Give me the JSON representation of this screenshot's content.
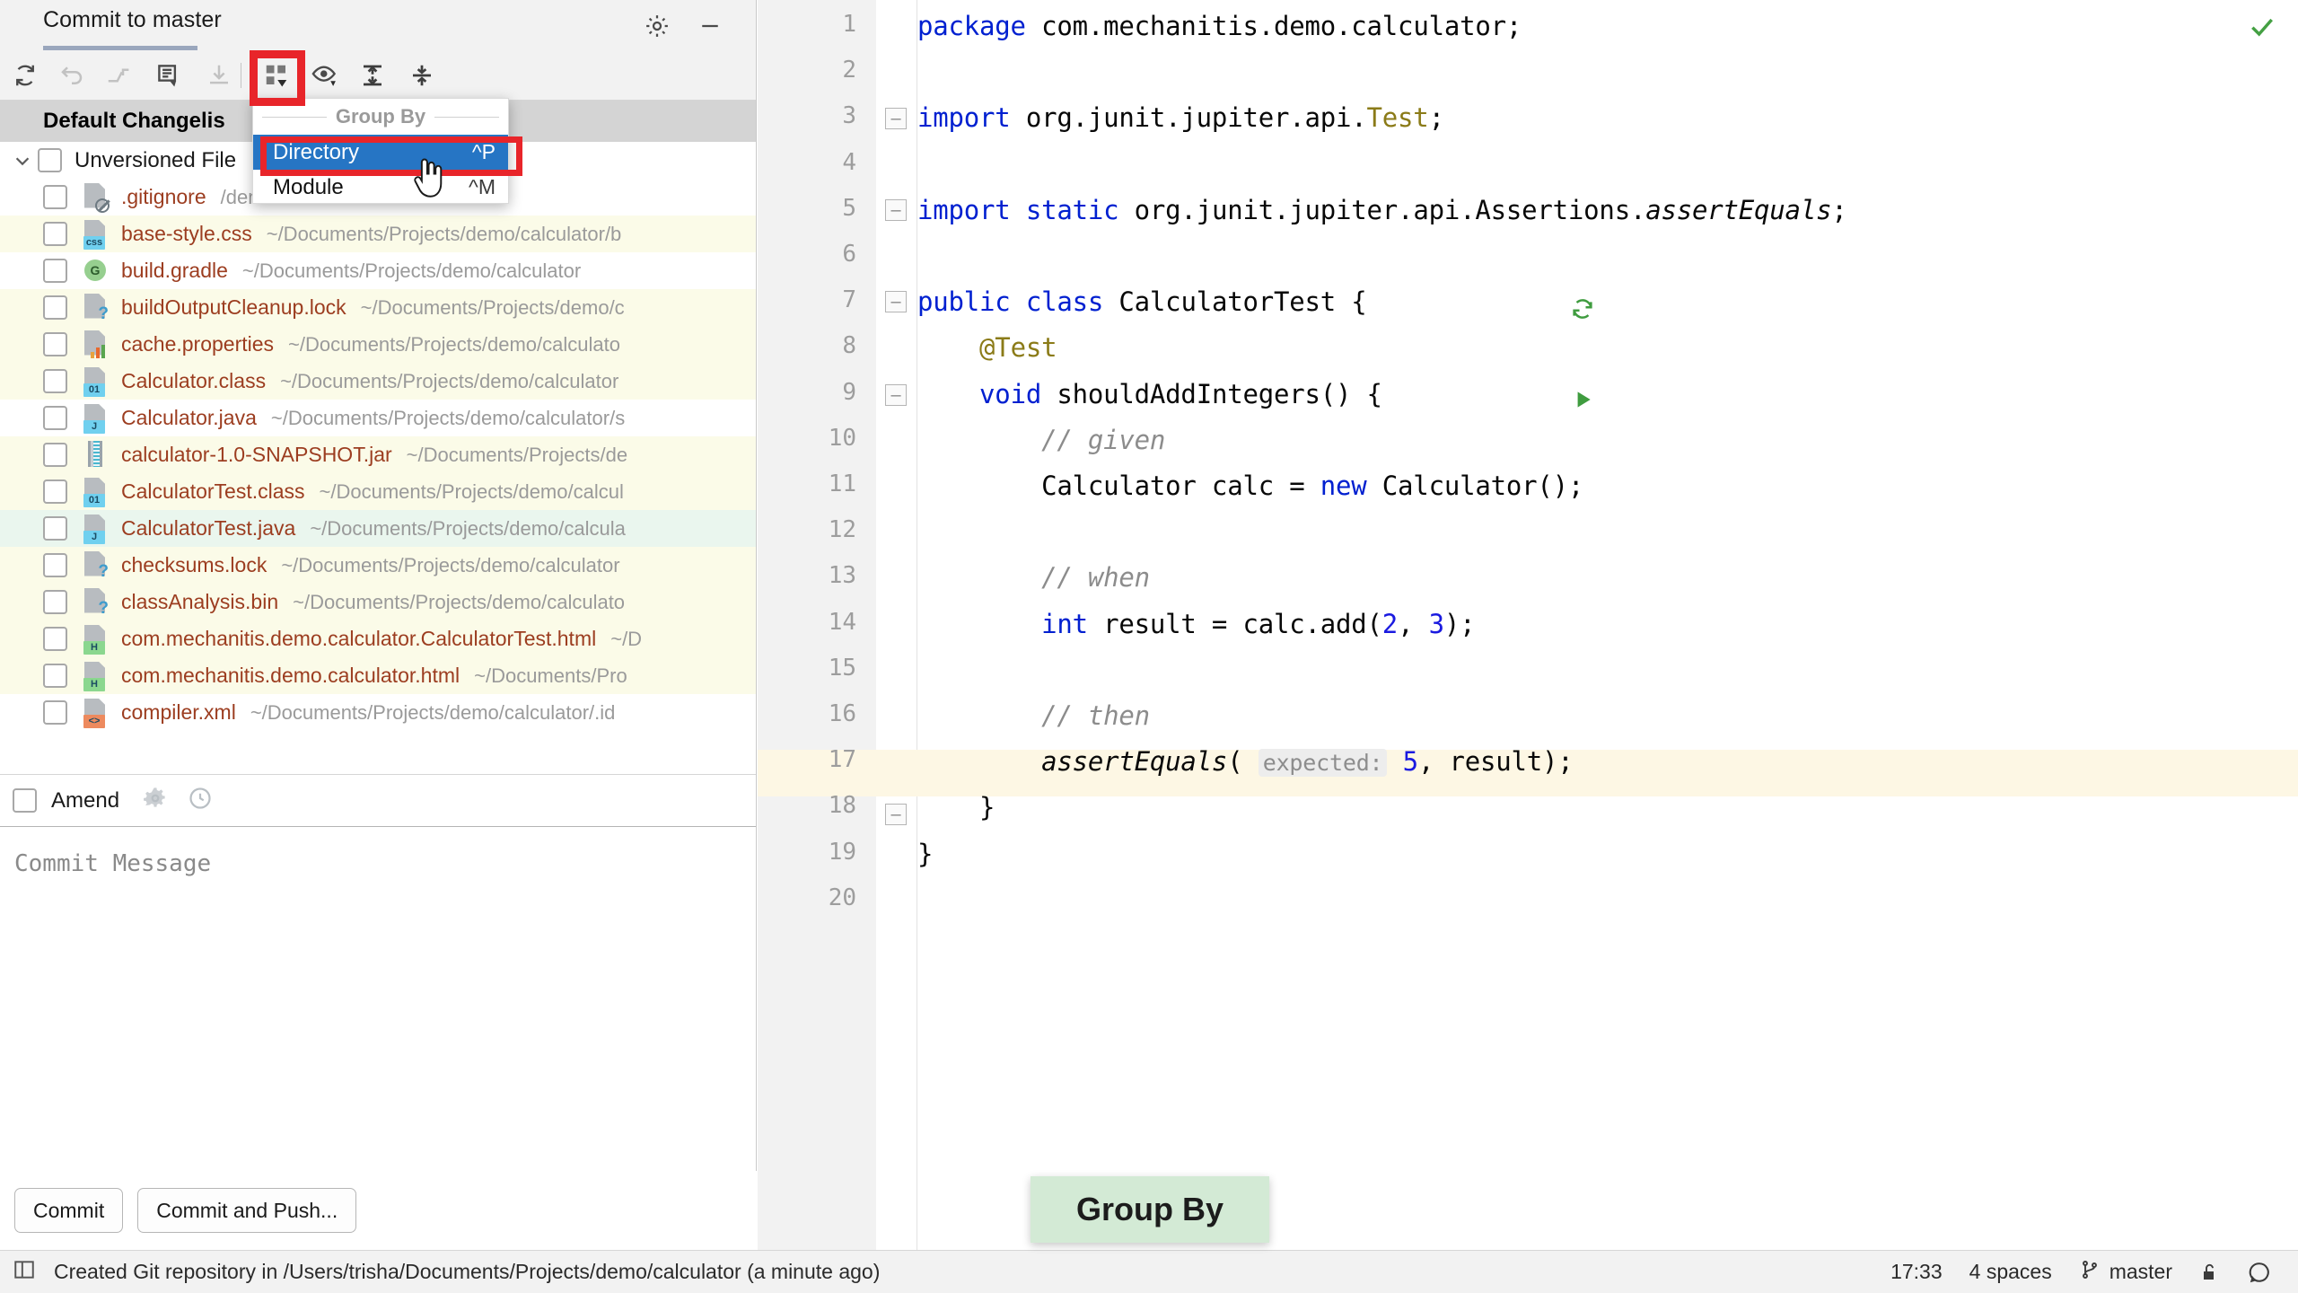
{
  "tool_window": {
    "tab_label": "Commit to master",
    "toolbar": [
      {
        "name": "refresh-icon",
        "enabled": true
      },
      {
        "name": "rollback-icon",
        "enabled": false
      },
      {
        "name": "move-to-another-changelist-icon",
        "enabled": false
      },
      {
        "name": "show-diff-icon",
        "enabled": true
      },
      {
        "name": "update-project-icon",
        "enabled": false
      },
      {
        "name": "group-by-icon",
        "enabled": true
      },
      {
        "name": "preview-diff-icon",
        "enabled": true
      },
      {
        "name": "expand-all-icon",
        "enabled": true
      },
      {
        "name": "collapse-all-icon",
        "enabled": true
      }
    ],
    "changelist_title": "Default Changelis",
    "gear_icon": "gear-icon",
    "minimize_icon": "minimize-icon"
  },
  "group_by_menu": {
    "caption": "Group By",
    "items": [
      {
        "label": "Directory",
        "shortcut": "^P",
        "selected": true
      },
      {
        "label": "Module",
        "shortcut": "^M",
        "selected": false
      }
    ]
  },
  "file_tree": {
    "root": {
      "label": "Unversioned File",
      "expanded": true
    },
    "files": [
      {
        "name": ".gitignore",
        "path": "/demo/calculator/.idea",
        "icon": "file-ignored-icon",
        "badge": "",
        "badge_color": "",
        "row": "white"
      },
      {
        "name": "base-style.css",
        "path": "~/Documents/Projects/demo/calculator/b",
        "icon": "css-file-icon",
        "badge": "css",
        "badge_color": "#70d0ef",
        "row": "yellow"
      },
      {
        "name": "build.gradle",
        "path": "~/Documents/Projects/demo/calculator",
        "icon": "gradle-file-icon",
        "badge": "",
        "badge_color": "",
        "row": "white"
      },
      {
        "name": "buildOutputCleanup.lock",
        "path": "~/Documents/Projects/demo/c",
        "icon": "unknown-file-icon",
        "badge": "",
        "badge_color": "",
        "row": "yellow"
      },
      {
        "name": "cache.properties",
        "path": "~/Documents/Projects/demo/calculato",
        "icon": "properties-file-icon",
        "badge": "",
        "badge_color": "",
        "row": "yellow"
      },
      {
        "name": "Calculator.class",
        "path": "~/Documents/Projects/demo/calculator",
        "icon": "class-file-icon",
        "badge": "01",
        "badge_color": "#70d0ef",
        "row": "yellow"
      },
      {
        "name": "Calculator.java",
        "path": "~/Documents/Projects/demo/calculator/s",
        "icon": "java-file-icon",
        "badge": "J",
        "badge_color": "#70d0ef",
        "row": "white"
      },
      {
        "name": "calculator-1.0-SNAPSHOT.jar",
        "path": "~/Documents/Projects/de",
        "icon": "jar-file-icon",
        "badge": "",
        "badge_color": "",
        "row": "yellow"
      },
      {
        "name": "CalculatorTest.class",
        "path": "~/Documents/Projects/demo/calcul",
        "icon": "class-file-icon",
        "badge": "01",
        "badge_color": "#70d0ef",
        "row": "yellow"
      },
      {
        "name": "CalculatorTest.java",
        "path": "~/Documents/Projects/demo/calcula",
        "icon": "java-file-icon",
        "badge": "J",
        "badge_color": "#70d0ef",
        "row": "green"
      },
      {
        "name": "checksums.lock",
        "path": "~/Documents/Projects/demo/calculator",
        "icon": "unknown-file-icon",
        "badge": "",
        "badge_color": "",
        "row": "yellow"
      },
      {
        "name": "classAnalysis.bin",
        "path": "~/Documents/Projects/demo/calculato",
        "icon": "unknown-file-icon",
        "badge": "",
        "badge_color": "",
        "row": "yellow"
      },
      {
        "name": "com.mechanitis.demo.calculator.CalculatorTest.html",
        "path": "~/D",
        "icon": "html-file-icon",
        "badge": "H",
        "badge_color": "#8bd78f",
        "row": "yellow"
      },
      {
        "name": "com.mechanitis.demo.calculator.html",
        "path": "~/Documents/Pro",
        "icon": "html-file-icon",
        "badge": "H",
        "badge_color": "#8bd78f",
        "row": "yellow"
      },
      {
        "name": "compiler.xml",
        "path": "~/Documents/Projects/demo/calculator/.id",
        "icon": "xml-file-icon",
        "badge": "<>",
        "badge_color": "#ed8a5e",
        "row": "white"
      }
    ]
  },
  "amend": {
    "label": "Amend",
    "checked": false,
    "settings_icon": "gear-icon",
    "history_icon": "history-clock-icon"
  },
  "commit_message": {
    "placeholder": "Commit Message",
    "value": ""
  },
  "commit_actions": {
    "commit_label": "Commit",
    "commit_and_push_label": "Commit and Push..."
  },
  "tooltip": {
    "text": "Group By",
    "background": "#d3ead5"
  },
  "editor": {
    "inspection_status_icon": "check-ok-icon",
    "line_numbers": [
      1,
      2,
      3,
      4,
      5,
      6,
      7,
      8,
      9,
      10,
      11,
      12,
      13,
      14,
      15,
      16,
      17,
      18,
      19,
      20
    ],
    "highlighted_line": 17,
    "gutter_marks": [
      {
        "line": 7,
        "icon": "run-test-class-icon"
      },
      {
        "line": 9,
        "icon": "run-test-method-icon"
      }
    ],
    "code": [
      {
        "line": 1,
        "text": "package com.mechanitis.demo.calculator;"
      },
      {
        "line": 2,
        "text": ""
      },
      {
        "line": 3,
        "text": "import org.junit.jupiter.api.Test;"
      },
      {
        "line": 4,
        "text": ""
      },
      {
        "line": 5,
        "text": "import static org.junit.jupiter.api.Assertions.assertEquals;"
      },
      {
        "line": 6,
        "text": ""
      },
      {
        "line": 7,
        "text": "public class CalculatorTest {"
      },
      {
        "line": 8,
        "text": "    @Test"
      },
      {
        "line": 9,
        "text": "    void shouldAddIntegers() {"
      },
      {
        "line": 10,
        "text": "        // given"
      },
      {
        "line": 11,
        "text": "        Calculator calc = new Calculator();"
      },
      {
        "line": 12,
        "text": ""
      },
      {
        "line": 13,
        "text": "        // when"
      },
      {
        "line": 14,
        "text": "        int result = calc.add(2, 3);"
      },
      {
        "line": 15,
        "text": ""
      },
      {
        "line": 16,
        "text": "        // then"
      },
      {
        "line": 17,
        "text": "        assertEquals( expected: 5, result);"
      },
      {
        "line": 18,
        "text": "    }"
      },
      {
        "line": 19,
        "text": "}"
      },
      {
        "line": 20,
        "text": ""
      }
    ]
  },
  "status_bar": {
    "message": "Created Git repository in /Users/trisha/Documents/Projects/demo/calculator (a minute ago)",
    "time": "17:33",
    "indent": "4 spaces",
    "branch": "master",
    "lock_icon": "unlock-icon",
    "notifications_icon": "notification-bubble-icon",
    "toggle_icon": "toggle-toolwindow-icon"
  },
  "colors": {
    "selection_blue": "#2675c4",
    "annotation_red": "#e8252a",
    "tooltip_green": "#d3ead5",
    "file_name": "#9c3d20",
    "file_path": "#9a9a9a"
  }
}
